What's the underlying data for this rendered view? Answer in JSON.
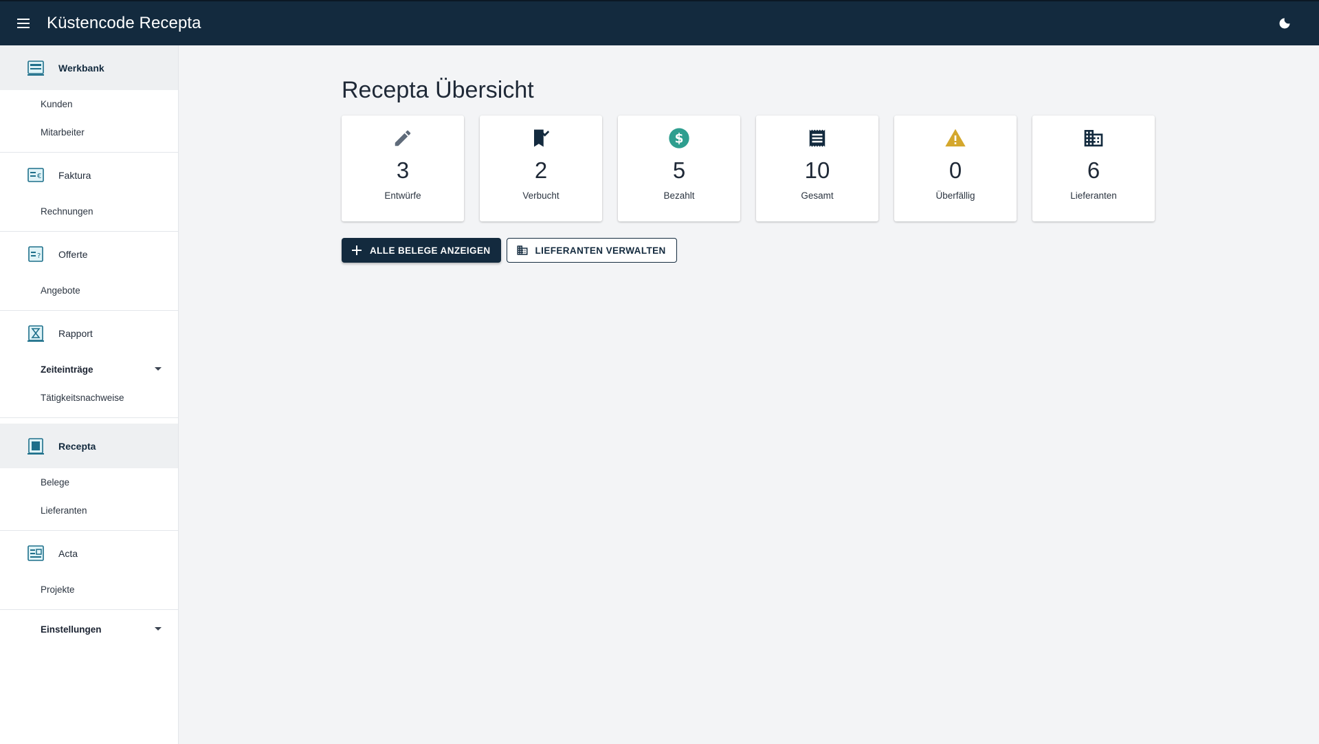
{
  "app": {
    "title": "Küstencode Recepta"
  },
  "sidebar": {
    "sections": [
      {
        "label": "Werkbank",
        "icon": "workbench-icon",
        "items": [
          "Kunden",
          "Mitarbeiter"
        ]
      },
      {
        "label": "Faktura",
        "icon": "invoice-icon",
        "items": [
          "Rechnungen"
        ]
      },
      {
        "label": "Offerte",
        "icon": "quote-icon",
        "items": [
          "Angebote"
        ]
      },
      {
        "label": "Rapport",
        "icon": "hourglass-icon",
        "items": [
          "Zeiteinträge",
          "Tätigkeitsnachweise"
        ]
      },
      {
        "label": "Recepta",
        "icon": "receipt-book-icon",
        "items": [
          "Belege",
          "Lieferanten"
        ]
      },
      {
        "label": "Acta",
        "icon": "acta-icon",
        "items": [
          "Projekte"
        ]
      },
      {
        "label": "Einstellungen"
      }
    ]
  },
  "main": {
    "title": "Recepta Übersicht",
    "cards": [
      {
        "value": "3",
        "label": "Entwürfe",
        "icon": "pencil-icon",
        "color": "#5f6b7a"
      },
      {
        "value": "2",
        "label": "Verbucht",
        "icon": "bookmark-check-icon",
        "color": "#132a3e"
      },
      {
        "value": "5",
        "label": "Bezahlt",
        "icon": "dollar-circle-icon",
        "color": "#2e9e8f"
      },
      {
        "value": "10",
        "label": "Gesamt",
        "icon": "receipt-icon",
        "color": "#132a3e"
      },
      {
        "value": "0",
        "label": "Überfällig",
        "icon": "warning-icon",
        "color": "#d4a72c"
      },
      {
        "value": "6",
        "label": "Lieferanten",
        "icon": "building-icon",
        "color": "#132a3e"
      }
    ],
    "buttons": {
      "all_receipts": "ALLE BELEGE ANZEIGEN",
      "manage_suppliers": "LIEFERANTEN VERWALTEN"
    }
  },
  "colors": {
    "topbar": "#132a3e",
    "accent": "#132a3e",
    "active_nav_bg": "#eef0f2"
  }
}
